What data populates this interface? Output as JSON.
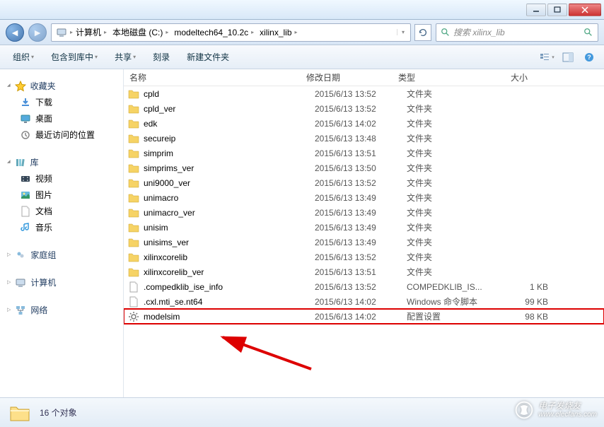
{
  "titlebar": {},
  "breadcrumb": {
    "parts": [
      "计算机",
      "本地磁盘 (C:)",
      "modeltech64_10.2c",
      "xilinx_lib"
    ]
  },
  "search": {
    "placeholder": "搜索 xilinx_lib"
  },
  "toolbar": {
    "organize": "组织",
    "include": "包含到库中",
    "share": "共享",
    "burn": "刻录",
    "newfolder": "新建文件夹"
  },
  "columns": {
    "name": "名称",
    "date": "修改日期",
    "type": "类型",
    "size": "大小"
  },
  "sidebar": {
    "favorites": {
      "title": "收藏夹",
      "items": [
        "下载",
        "桌面",
        "最近访问的位置"
      ]
    },
    "libraries": {
      "title": "库",
      "items": [
        "视频",
        "图片",
        "文档",
        "音乐"
      ]
    },
    "homegroup": {
      "title": "家庭组"
    },
    "computer": {
      "title": "计算机"
    },
    "network": {
      "title": "网络"
    }
  },
  "files": [
    {
      "name": "cpld",
      "date": "2015/6/13 13:52",
      "type": "文件夹",
      "size": "",
      "icon": "folder"
    },
    {
      "name": "cpld_ver",
      "date": "2015/6/13 13:52",
      "type": "文件夹",
      "size": "",
      "icon": "folder"
    },
    {
      "name": "edk",
      "date": "2015/6/13 14:02",
      "type": "文件夹",
      "size": "",
      "icon": "folder"
    },
    {
      "name": "secureip",
      "date": "2015/6/13 13:48",
      "type": "文件夹",
      "size": "",
      "icon": "folder"
    },
    {
      "name": "simprim",
      "date": "2015/6/13 13:51",
      "type": "文件夹",
      "size": "",
      "icon": "folder"
    },
    {
      "name": "simprims_ver",
      "date": "2015/6/13 13:50",
      "type": "文件夹",
      "size": "",
      "icon": "folder"
    },
    {
      "name": "uni9000_ver",
      "date": "2015/6/13 13:52",
      "type": "文件夹",
      "size": "",
      "icon": "folder"
    },
    {
      "name": "unimacro",
      "date": "2015/6/13 13:49",
      "type": "文件夹",
      "size": "",
      "icon": "folder"
    },
    {
      "name": "unimacro_ver",
      "date": "2015/6/13 13:49",
      "type": "文件夹",
      "size": "",
      "icon": "folder"
    },
    {
      "name": "unisim",
      "date": "2015/6/13 13:49",
      "type": "文件夹",
      "size": "",
      "icon": "folder"
    },
    {
      "name": "unisims_ver",
      "date": "2015/6/13 13:49",
      "type": "文件夹",
      "size": "",
      "icon": "folder"
    },
    {
      "name": "xilinxcorelib",
      "date": "2015/6/13 13:52",
      "type": "文件夹",
      "size": "",
      "icon": "folder"
    },
    {
      "name": "xilinxcorelib_ver",
      "date": "2015/6/13 13:51",
      "type": "文件夹",
      "size": "",
      "icon": "folder"
    },
    {
      "name": ".compedklib_ise_info",
      "date": "2015/6/13 13:52",
      "type": "COMPEDKLIB_IS...",
      "size": "1 KB",
      "icon": "file"
    },
    {
      "name": ".cxl.mti_se.nt64",
      "date": "2015/6/13 14:02",
      "type": "Windows 命令脚本",
      "size": "99 KB",
      "icon": "file"
    },
    {
      "name": "modelsim",
      "date": "2015/6/13 14:02",
      "type": "配置设置",
      "size": "98 KB",
      "icon": "settings",
      "highlight": true
    }
  ],
  "statusbar": {
    "count": "16 个对象"
  },
  "watermark": {
    "line1": "电子发烧友",
    "line2": "www.elecfans.com"
  }
}
